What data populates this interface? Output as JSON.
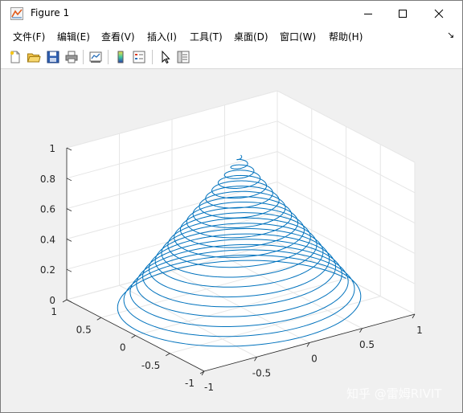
{
  "window": {
    "title": "Figure 1",
    "controls": {
      "minimize": "—",
      "maximize": "☐",
      "close": "✕"
    }
  },
  "menu": {
    "items": [
      "文件(F)",
      "编辑(E)",
      "查看(V)",
      "插入(I)",
      "工具(T)",
      "桌面(D)",
      "窗口(W)",
      "帮助(H)"
    ],
    "dock_arrow": "↘"
  },
  "toolbar": {
    "icons": [
      "new-figure-icon",
      "open-file-icon",
      "save-icon",
      "print-icon",
      "link-plot-icon",
      "colorbar-icon",
      "legend-icon",
      "edit-plot-arrow-icon",
      "property-inspector-icon"
    ]
  },
  "colors": {
    "line": "#0072BD",
    "axes_bg": "#ffffff",
    "figure_bg": "#f0f0f0",
    "grid": "#e6e6e6"
  },
  "watermark": "知乎 @雷姆RIVIT",
  "chart_data": {
    "type": "line",
    "projection": "3d",
    "description_of_data": "x = (1 - z)·cos(t), y = (1 - z)·sin(t), z increasing from 0 to 1 over about 20 turns",
    "turns": 20,
    "xlim": [
      -1,
      1
    ],
    "ylim": [
      -1,
      1
    ],
    "zlim": [
      0,
      1
    ],
    "x_ticks": [
      "-1",
      "-0.5",
      "0",
      "0.5",
      "1"
    ],
    "y_ticks": [
      "-1",
      "-0.5",
      "0",
      "0.5",
      "1"
    ],
    "z_ticks": [
      "0",
      "0.2",
      "0.4",
      "0.6",
      "0.8",
      "1"
    ],
    "grid": true,
    "series": [
      {
        "color": "#0072BD"
      }
    ]
  }
}
